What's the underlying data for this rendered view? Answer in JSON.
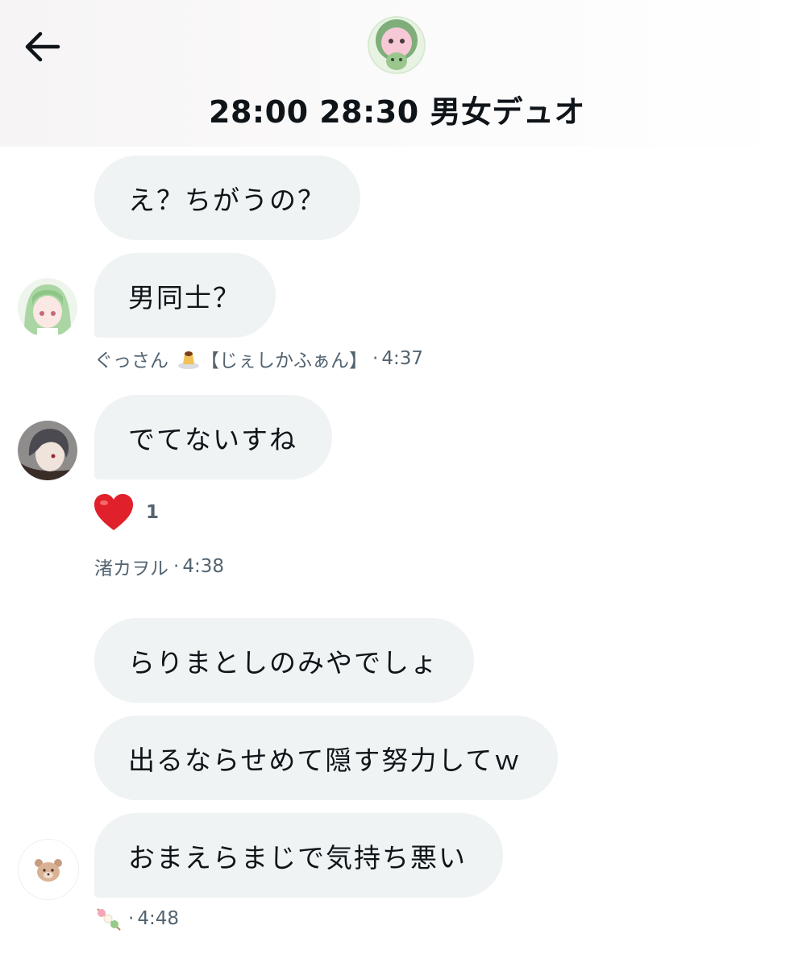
{
  "header": {
    "title": "28:00 28:30 男女デュオ",
    "back_icon": "arrow-left-icon"
  },
  "messages": [
    {
      "text": "え？ちがうの？"
    },
    {
      "text": "男同士？"
    },
    {
      "text": "でてないすね"
    },
    {
      "text": "らりまとしのみやでしょ"
    },
    {
      "text": "出るならせめて隠す努力してｗ"
    },
    {
      "text": "おまえらまじで気持ち悪い"
    }
  ],
  "meta": [
    {
      "sender": "ぐっさん",
      "badge": "【じぇしかふぁん】",
      "time": "4:37",
      "emoji_icon": "pudding-icon"
    },
    {
      "sender": "渚カヲル",
      "time": "4:38"
    },
    {
      "sender": "",
      "time": "4:48",
      "emoji_icon": "dango-icon"
    }
  ],
  "reaction": {
    "emoji": "❤️",
    "count": "1"
  },
  "colors": {
    "bubble": "#eff3f4",
    "meta_text": "#536471",
    "text": "#0f1419"
  }
}
